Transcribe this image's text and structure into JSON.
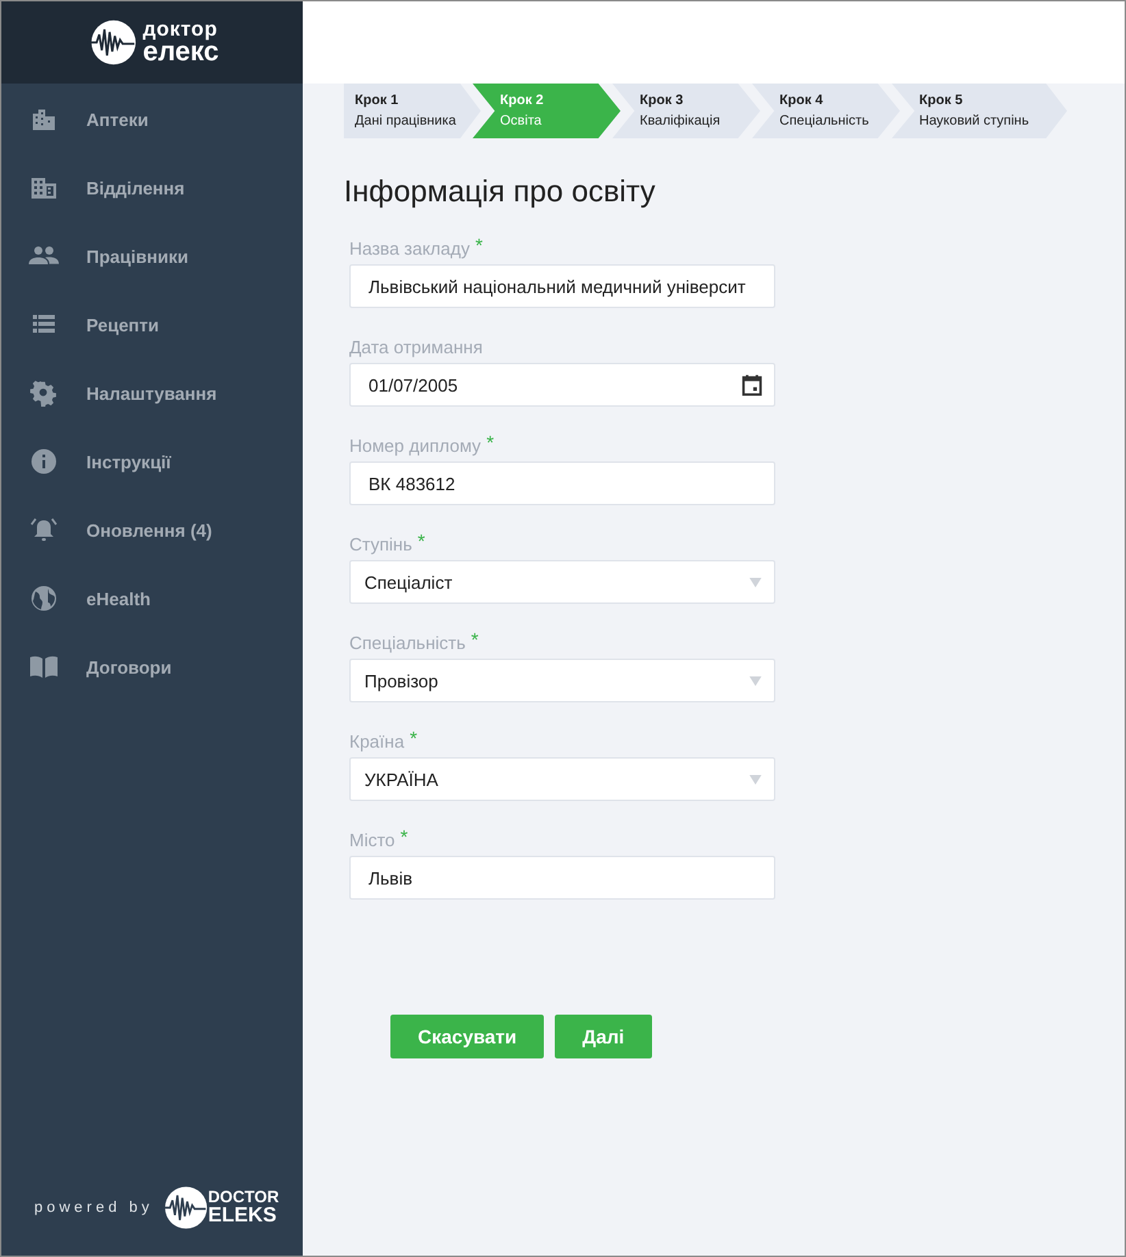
{
  "logo": {
    "line_1": "доктор",
    "line_2": "елекс"
  },
  "sidebar": {
    "items": [
      {
        "label": "Аптеки"
      },
      {
        "label": "Відділення"
      },
      {
        "label": "Працівники"
      },
      {
        "label": "Рецепти"
      },
      {
        "label": "Налаштування"
      },
      {
        "label": "Інструкції"
      },
      {
        "label": "Оновлення (4)"
      },
      {
        "label": "eHealth"
      },
      {
        "label": "Договори"
      }
    ]
  },
  "footer": {
    "powered_by": "powered by",
    "brand_line_1": "DOCTOR",
    "brand_line_2": "ELEKS"
  },
  "steps": [
    {
      "step": "Крок 1",
      "label": "Дані працівника",
      "selected": false
    },
    {
      "step": "Крок 2",
      "label": "Освіта",
      "selected": true
    },
    {
      "step": "Крок 3",
      "label": "Кваліфікація",
      "selected": false
    },
    {
      "step": "Крок 4",
      "label": "Спеціальність",
      "selected": false
    },
    {
      "step": "Крок 5",
      "label": "Науковий ступінь",
      "selected": false
    }
  ],
  "title": "Інформація про освіту",
  "fields": [
    {
      "kind": "text",
      "label": "Назва закладу",
      "required_mark": "*",
      "value": "Львівський національний медичний університ"
    },
    {
      "kind": "date",
      "label": "Дата отримання",
      "value": "01/07/2005"
    },
    {
      "kind": "text",
      "label": "Номер диплому",
      "required_mark": "*",
      "value": "ВК 483612"
    },
    {
      "kind": "select",
      "label": "Ступінь",
      "required_mark": "*",
      "value": "Спеціаліст"
    },
    {
      "kind": "select",
      "label": "Спеціальність",
      "required_mark": "*",
      "value": "Провізор"
    },
    {
      "kind": "select",
      "label": "Країна",
      "required_mark": "*",
      "value": "УКРАЇНА"
    },
    {
      "kind": "text",
      "label": "Місто",
      "required_mark": "*",
      "value": "Львів"
    }
  ],
  "buttons": [
    "Скасувати",
    "Далі"
  ]
}
